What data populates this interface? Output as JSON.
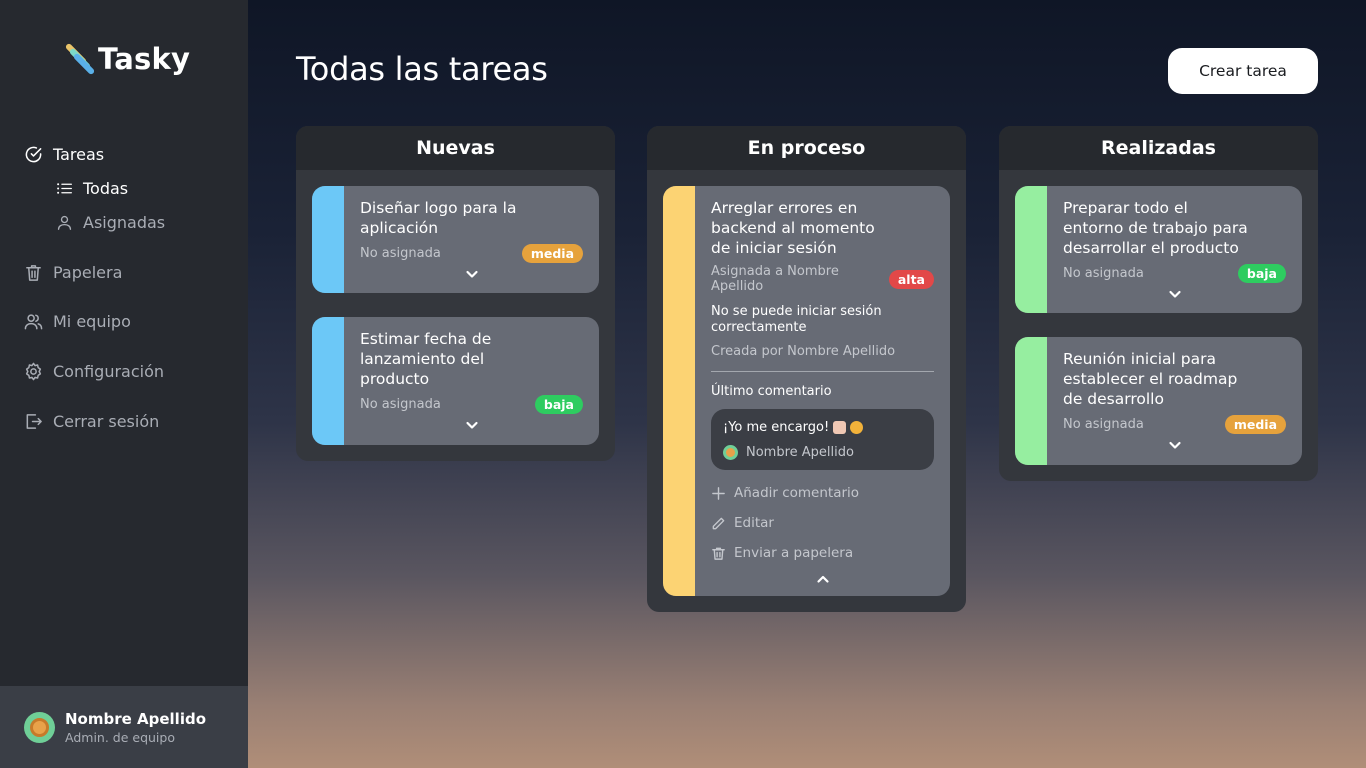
{
  "app": {
    "name": "Tasky",
    "logo_colors": [
      "#e9c46a",
      "#7cd9c8",
      "#5ab0e8"
    ]
  },
  "sidebar": {
    "items": [
      {
        "label": "Tareas",
        "icon": "check-circle-icon",
        "active": true
      },
      {
        "label": "Todas",
        "icon": "list-icon",
        "active": true
      },
      {
        "label": "Asignadas",
        "icon": "user-icon",
        "active": false
      },
      {
        "label": "Papelera",
        "icon": "trash-icon",
        "active": false
      },
      {
        "label": "Mi equipo",
        "icon": "team-icon",
        "active": false
      },
      {
        "label": "Configuración",
        "icon": "gear-icon",
        "active": false
      },
      {
        "label": "Cerrar sesión",
        "icon": "logout-icon",
        "active": false
      }
    ],
    "profile": {
      "name": "Nombre Apellido",
      "role": "Admin. de equipo"
    }
  },
  "header": {
    "title": "Todas las tareas",
    "create_label": "Crear tarea"
  },
  "priority_colors": {
    "alta": "#e24848",
    "media": "#e6a23c",
    "baja": "#2ecc60"
  },
  "columns": [
    {
      "title": "Nuevas",
      "color": "#6cc8f7",
      "cards": [
        {
          "title": "Diseñar logo para la aplicación",
          "assignee": "No asignada",
          "priority": "media"
        },
        {
          "title": "Estimar fecha de lanzamiento del producto",
          "assignee": "No asignada",
          "priority": "baja"
        }
      ]
    },
    {
      "title": "En proceso",
      "color": "#fcd373",
      "cards": [
        {
          "title": "Arreglar errores en backend al momento de iniciar sesión",
          "assignee": "Asignada a Nombre Apellido",
          "priority": "alta",
          "description": "No se puede iniciar sesión correctamente",
          "created_by": "Creada por Nombre Apellido",
          "last_comment_label": "Último comentario",
          "comment": {
            "text": "¡Yo me encargo!",
            "author": "Nombre Apellido"
          },
          "actions": {
            "add_comment": "Añadir comentario",
            "edit": "Editar",
            "trash": "Enviar a papelera"
          }
        }
      ]
    },
    {
      "title": "Realizadas",
      "color": "#96eea0",
      "cards": [
        {
          "title": "Preparar todo el entorno de trabajo para desarrollar el producto",
          "assignee": "No asignada",
          "priority": "baja"
        },
        {
          "title": "Reunión inicial para establecer el roadmap de desarrollo",
          "assignee": "No asignada",
          "priority": "media"
        }
      ]
    }
  ]
}
